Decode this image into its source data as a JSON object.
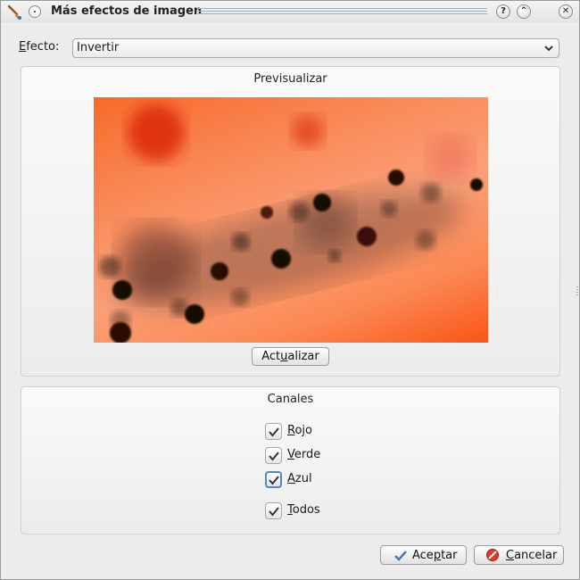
{
  "window": {
    "title": "Más efectos de imagen",
    "icons": {
      "app": "paintbrush-icon",
      "menu": "window-menu-icon",
      "help": "help-icon",
      "shade": "shade-icon",
      "close": "close-icon"
    },
    "help_glyph": "?",
    "shade_glyph": "⌃",
    "close_glyph": "✕"
  },
  "effect": {
    "label_access_key": "E",
    "label_rest": "fecto:",
    "selected": "Invertir",
    "dropdown_icon": "chevron-down-icon"
  },
  "preview": {
    "title": "Previsualizar",
    "image_desc_icon": "preview-image",
    "update_button": {
      "pre": "Act",
      "key": "u",
      "post": "alizar"
    }
  },
  "channels": {
    "title": "Canales",
    "items": [
      {
        "key": "R",
        "rest": "ojo",
        "checked": true
      },
      {
        "key": "V",
        "rest": "erde",
        "checked": true
      },
      {
        "key": "A",
        "rest": "zul",
        "checked": true
      },
      {
        "key": "T",
        "rest": "odos",
        "checked": true
      }
    ]
  },
  "buttons": {
    "ok": {
      "pre": "Ace",
      "key": "p",
      "post": "tar",
      "icon": "checkmark-icon"
    },
    "cancel": {
      "pre": "",
      "key": "C",
      "post": "ancelar",
      "icon": "cancel-icon"
    }
  },
  "colors": {
    "accent": "#5b84b8",
    "preview_orange": "#f76a2a"
  }
}
